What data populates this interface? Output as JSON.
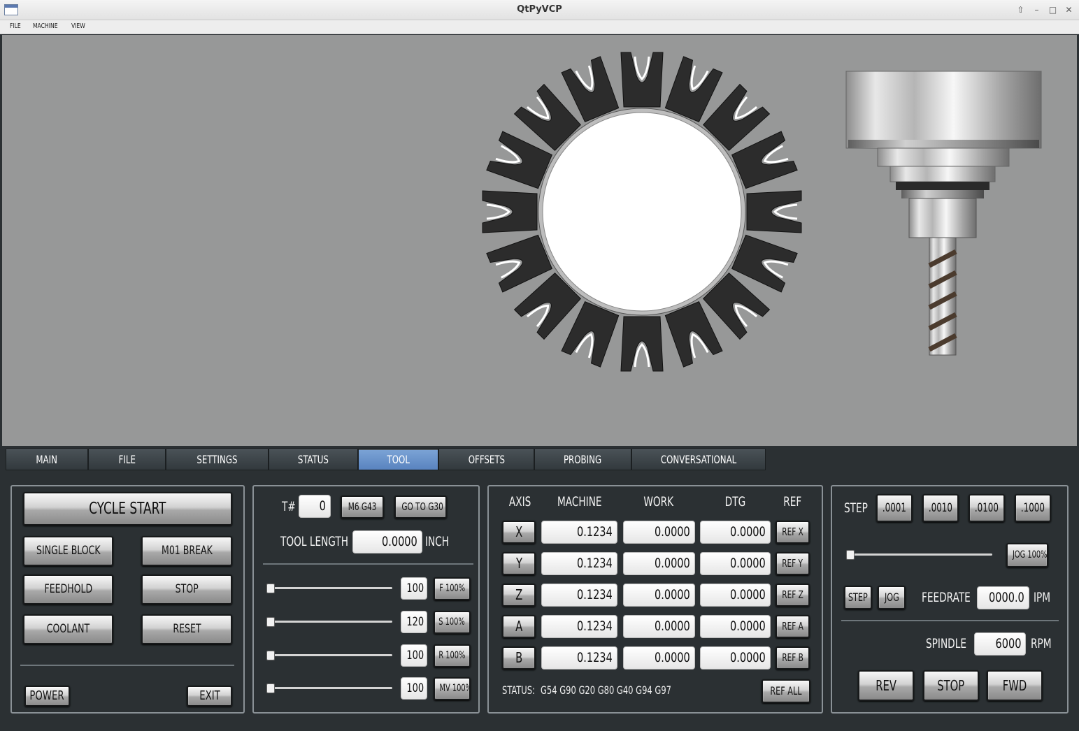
{
  "window": {
    "title": "QtPyVCP"
  },
  "menu": [
    "FILE",
    "MACHINE",
    "VIEW"
  ],
  "tabs": [
    "MAIN",
    "FILE",
    "SETTINGS",
    "STATUS",
    "TOOL",
    "OFFSETS",
    "PROBING",
    "CONVERSATIONAL"
  ],
  "active_tab": "TOOL",
  "control": {
    "cycle_start": "CYCLE START",
    "single_block": "SINGLE BLOCK",
    "m01_break": "M01 BREAK",
    "feedhold": "FEEDHOLD",
    "stop": "STOP",
    "coolant": "COOLANT",
    "reset": "RESET",
    "power": "POWER",
    "exit": "EXIT"
  },
  "tool": {
    "tnum_label": "T#",
    "tnum_value": "0",
    "m6g43": "M6 G43",
    "goto_g30": "GO TO G30",
    "length_label": "TOOL LENGTH",
    "length_value": "0.0000",
    "length_unit": "INCH",
    "overrides": [
      {
        "value": "100",
        "button": "F 100%",
        "level": 0
      },
      {
        "value": "120",
        "button": "S 100%",
        "level": 0
      },
      {
        "value": "100",
        "button": "R 100%",
        "level": 0
      },
      {
        "value": "100",
        "button": "MV 100%",
        "level": 0
      }
    ]
  },
  "dro": {
    "headers": {
      "axis": "AXIS",
      "machine": "MACHINE",
      "work": "WORK",
      "dtg": "DTG",
      "ref": "REF"
    },
    "rows": [
      {
        "axis": "X",
        "machine": "0.1234",
        "work": "0.0000",
        "dtg": "0.0000",
        "ref": "REF X"
      },
      {
        "axis": "Y",
        "machine": "0.1234",
        "work": "0.0000",
        "dtg": "0.0000",
        "ref": "REF Y"
      },
      {
        "axis": "Z",
        "machine": "0.1234",
        "work": "0.0000",
        "dtg": "0.0000",
        "ref": "REF Z"
      },
      {
        "axis": "A",
        "machine": "0.1234",
        "work": "0.0000",
        "dtg": "0.0000",
        "ref": "REF A"
      },
      {
        "axis": "B",
        "machine": "0.1234",
        "work": "0.0000",
        "dtg": "0.0000",
        "ref": "REF B"
      }
    ],
    "status_label": "STATUS:",
    "gcodes": "G54  G90  G20  G80  G40  G94  G97",
    "ref_all": "REF ALL"
  },
  "jog": {
    "step_label": "STEP",
    "steps": [
      ".0001",
      ".0010",
      ".0100",
      ".1000"
    ],
    "jog_override": "JOG 100%",
    "jog_level": 0,
    "step_btn": "STEP",
    "jog_btn": "JOG",
    "feedrate_label": "FEEDRATE",
    "feedrate_value": "0000.0",
    "feedrate_unit": "IPM",
    "spindle_label": "SPINDLE",
    "spindle_value": "6000",
    "spindle_unit": "RPM",
    "rev": "REV",
    "stop": "STOP",
    "fwd": "FWD"
  },
  "icons": {
    "app": "window-icon",
    "controls": [
      "restore-icon",
      "minimize-icon",
      "maximize-icon",
      "close-icon"
    ]
  }
}
